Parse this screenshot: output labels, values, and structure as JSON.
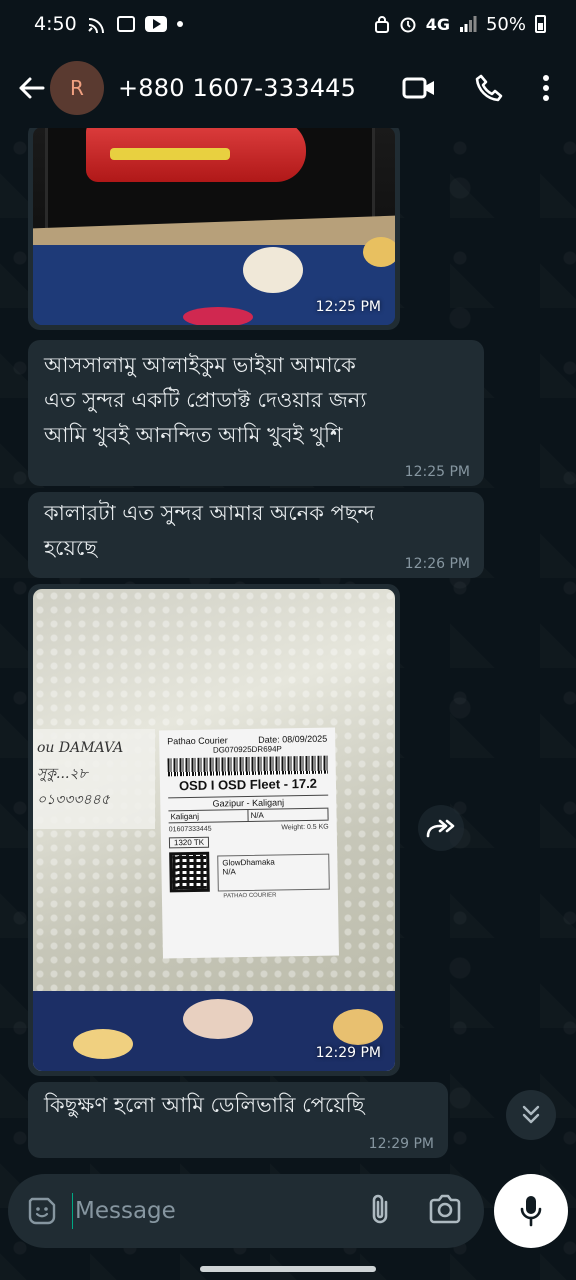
{
  "status_bar": {
    "time": "4:50",
    "network": "4G",
    "battery": "50%"
  },
  "header": {
    "avatar_initial": "R",
    "contact_name": "+880 1607-333445"
  },
  "messages": [
    {
      "type": "image",
      "time": "12:25 PM"
    },
    {
      "type": "text",
      "text_lines": [
        "আসসালামু আলাইকুম ভাইয়া আমাকে",
        "এত সুন্দর একটি প্রোডাক্ট দেওয়ার জন্য",
        "আমি খুবই আনন্দিত আমি খুবই খুশি"
      ],
      "time": "12:25 PM"
    },
    {
      "type": "text",
      "text_lines": [
        "কালারটা এত সুন্দর আমার অনেক পছন্দ",
        "হয়েছে"
      ],
      "time": "12:26 PM"
    },
    {
      "type": "image",
      "time": "12:29 PM"
    },
    {
      "type": "text",
      "text_lines": [
        "কিছুক্ষণ হলো আমি ডেলিভারি পেয়েছি"
      ],
      "time": "12:29 PM"
    }
  ],
  "parcel_label": {
    "courier": "Pathao Courier",
    "date": "Date: 08/09/2025",
    "code": "DG070925DR694P",
    "fleet": "OSD I OSD Fleet - 17.2",
    "route": "Gazipur - Kaliganj",
    "area": "Kaliganj",
    "na": "N/A",
    "phone": "01607333445",
    "weight": "Weight: 0.5 KG",
    "price": "1320 TK",
    "merchant": "GlowDhamaka",
    "merchant_na": "N/A",
    "footer": "PATHAO COURIER",
    "handwriting_1": "ou DAMAVA",
    "handwriting_2": "সুকু...২৮",
    "handwriting_3": "০১৩৩৩৪৪৫"
  },
  "input": {
    "placeholder": "Message"
  }
}
